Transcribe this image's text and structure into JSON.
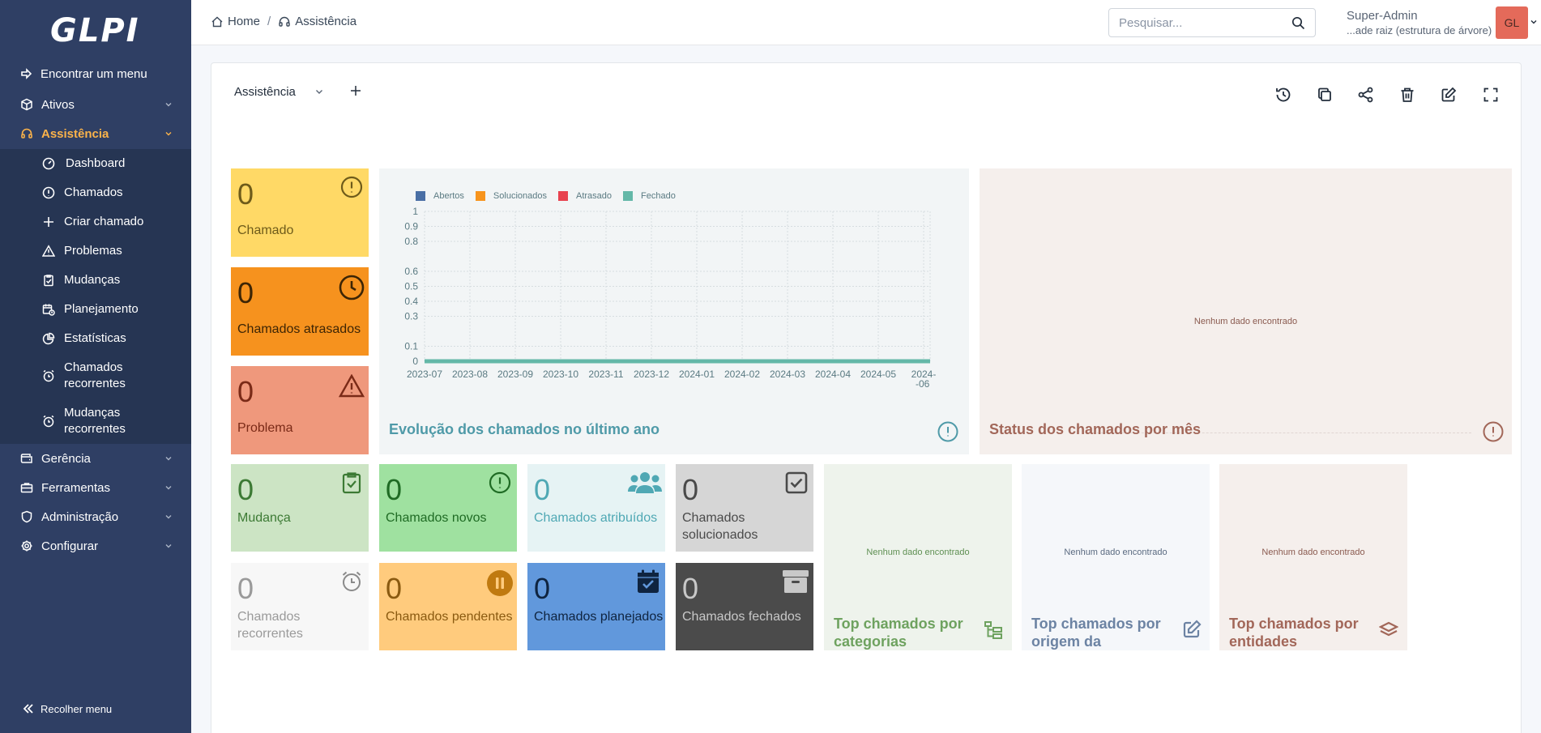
{
  "app": {
    "logo_text": "GLPI"
  },
  "sidebar": {
    "find_menu": "Encontrar um menu",
    "items": [
      {
        "label": "Ativos"
      },
      {
        "label": "Assistência"
      }
    ],
    "submenu": [
      {
        "label": "Dashboard"
      },
      {
        "label": "Chamados"
      },
      {
        "label": "Criar chamado"
      },
      {
        "label": "Problemas"
      },
      {
        "label": "Mudanças"
      },
      {
        "label": "Planejamento"
      },
      {
        "label": "Estatísticas"
      },
      {
        "label": "Chamados recorrentes"
      },
      {
        "label": "Mudanças recorrentes"
      }
    ],
    "after": [
      {
        "label": "Gerência"
      },
      {
        "label": "Ferramentas"
      },
      {
        "label": "Administração"
      },
      {
        "label": "Configurar"
      }
    ],
    "collapse_label": "Recolher menu",
    "colors": {
      "bg": "#2f3f64",
      "active": "#fbb34a"
    }
  },
  "topbar": {
    "breadcrumb": [
      {
        "label": "Home"
      },
      {
        "label": "Assistência"
      }
    ],
    "search_placeholder": "Pesquisar...",
    "user_name": "Super-Admin",
    "user_entity": "...ade raiz (estrutura de árvore)",
    "avatar_initials": "GL"
  },
  "dashboard": {
    "selected": "Assistência",
    "tools": [
      "history-icon",
      "clone-icon",
      "share-icon",
      "delete-icon",
      "edit-icon",
      "fullscreen-icon"
    ]
  },
  "widgets": {
    "chamado": {
      "value": "0",
      "label": "Chamado",
      "color": "#ffd966"
    },
    "atrasados": {
      "value": "0",
      "label": "Chamados atrasados",
      "color": "#f6921e"
    },
    "problema": {
      "value": "0",
      "label": "Problema",
      "color": "#ef987c"
    },
    "mudanca": {
      "value": "0",
      "label": "Mudança",
      "color": "#cce4c4"
    },
    "novos": {
      "value": "0",
      "label": "Chamados novos",
      "color": "#9fe1a0"
    },
    "atribuidos": {
      "value": "0",
      "label": "Chamados atribuídos",
      "color": "#e6f3f4"
    },
    "solucionados": {
      "value": "0",
      "label": "Chamados solucionados",
      "color": "#d6d6d6"
    },
    "recorrentes": {
      "value": "0",
      "label": "Chamados recorrentes",
      "color": "#f7f7f7"
    },
    "pendentes": {
      "value": "0",
      "label": "Chamados pendentes",
      "color": "#ffcb7d"
    },
    "planejados": {
      "value": "0",
      "label": "Chamados planejados",
      "color": "#6198dc"
    },
    "fechados": {
      "value": "0",
      "label": "Chamados fechados",
      "color": "#4b4b4b"
    },
    "status_mes": {
      "title": "Status dos chamados por mês",
      "empty": "Nenhum dado encontrado"
    },
    "top_categorias": {
      "title": "Top chamados por categorias",
      "empty": "Nenhum dado encontrado"
    },
    "top_origem": {
      "title": "Top chamados por origem da requisição",
      "empty": "Nenhum dado encontrado"
    },
    "top_entidades": {
      "title": "Top chamados por entidades",
      "empty": "Nenhum dado encontrado"
    }
  },
  "chart_data": {
    "type": "line",
    "title": "Evolução dos chamados no último ano",
    "x": [
      "2023-07",
      "2023-08",
      "2023-09",
      "2023-10",
      "2023-11",
      "2023-12",
      "2024-01",
      "2024-02",
      "2024-03",
      "2024-04",
      "2024-05",
      "2024-06"
    ],
    "x_labels_display": [
      "2023-07",
      "2023-08",
      "2023-09",
      "2023-10",
      "2023-11",
      "2023-12",
      "2024-01",
      "2024-02",
      "2024-03",
      "2024-04",
      "2024-05",
      "2024-\n-06"
    ],
    "series": [
      {
        "name": "Abertos",
        "color": "#4a6fa5",
        "values": [
          0,
          0,
          0,
          0,
          0,
          0,
          0,
          0,
          0,
          0,
          0,
          0
        ]
      },
      {
        "name": "Solucionados",
        "color": "#f7941d",
        "values": [
          0,
          0,
          0,
          0,
          0,
          0,
          0,
          0,
          0,
          0,
          0,
          0
        ]
      },
      {
        "name": "Atrasado",
        "color": "#e8424f",
        "values": [
          0,
          0,
          0,
          0,
          0,
          0,
          0,
          0,
          0,
          0,
          0,
          0
        ]
      },
      {
        "name": "Fechado",
        "color": "#64b8a8",
        "values": [
          0,
          0,
          0,
          0,
          0,
          0,
          0,
          0,
          0,
          0,
          0,
          0
        ]
      }
    ],
    "yticks": [
      "1",
      "0.9",
      "0.8",
      "0.6",
      "0.5",
      "0.4",
      "0.3",
      "0.1",
      "0"
    ],
    "ylim": [
      0,
      1
    ],
    "grid": true,
    "legend": "top-left"
  }
}
